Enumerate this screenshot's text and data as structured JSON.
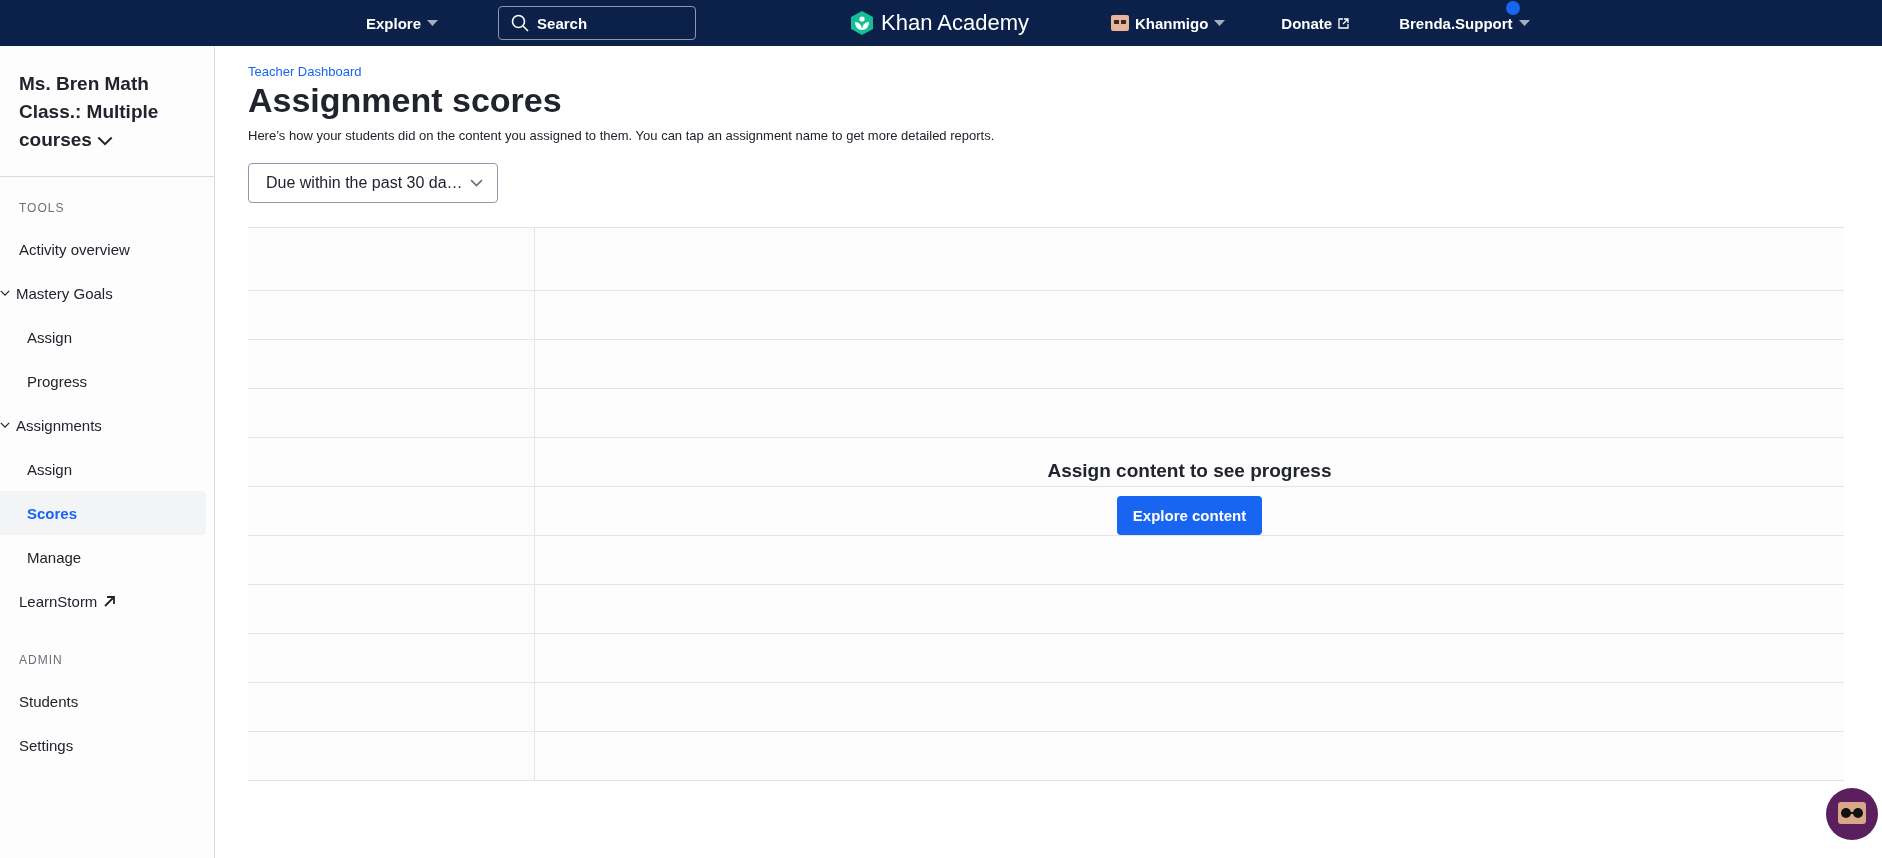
{
  "top_bar": {
    "explore": "Explore",
    "search": {
      "placeholder": "Search"
    },
    "logo": "Khan Academy",
    "khanmigo": "Khanmigo",
    "donate": "Donate",
    "user": "Brenda.Support",
    "notification_dot": true
  },
  "sidebar": {
    "class_name": "Ms. Bren Math Class.: Multiple courses",
    "sections": [
      {
        "heading": "TOOLS",
        "items": [
          {
            "kind": "item",
            "label": "Activity overview",
            "selected": false
          },
          {
            "kind": "group",
            "label": "Mastery Goals",
            "expanded": true,
            "children": [
              {
                "label": "Assign",
                "selected": false
              },
              {
                "label": "Progress",
                "selected": false
              }
            ]
          },
          {
            "kind": "group",
            "label": "Assignments",
            "expanded": true,
            "children": [
              {
                "label": "Assign",
                "selected": false
              },
              {
                "label": "Scores",
                "selected": true
              },
              {
                "label": "Manage",
                "selected": false
              }
            ]
          },
          {
            "kind": "external",
            "label": "LearnStorm",
            "selected": false
          }
        ]
      },
      {
        "heading": "ADMIN",
        "items": [
          {
            "kind": "item",
            "label": "Students",
            "selected": false
          },
          {
            "kind": "item",
            "label": "Settings",
            "selected": false
          }
        ]
      }
    ]
  },
  "main": {
    "breadcrumb": "Teacher Dashboard",
    "title": "Assignment scores",
    "description": "Here’s how your students did on the content you assigned to them. You can tap an assignment name to get more detailed reports.",
    "filter": "Due within the past 30 da…",
    "empty_state": {
      "message": "Assign content to see progress",
      "button": "Explore content"
    }
  }
}
